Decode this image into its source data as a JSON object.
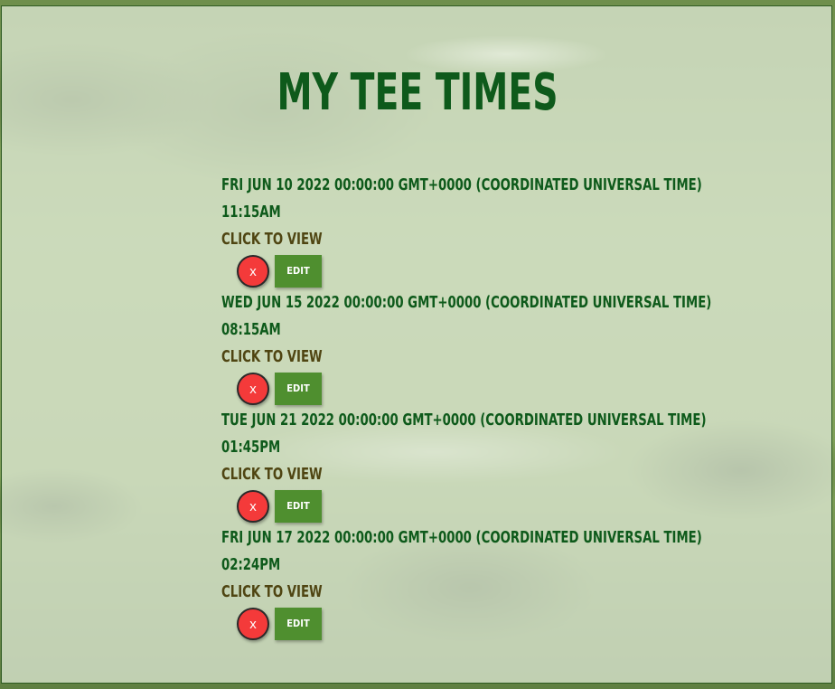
{
  "page": {
    "title": "MY TEE TIMES"
  },
  "tee_times": [
    {
      "date": "Fri Jun 10 2022 00:00:00 GMT+0000 (Coordinated Universal Time)",
      "time": "11:15AM",
      "view_label": "Click to view",
      "delete_label": "x",
      "edit_label": "EDIT"
    },
    {
      "date": "Wed Jun 15 2022 00:00:00 GMT+0000 (Coordinated Universal Time)",
      "time": "08:15AM",
      "view_label": "Click to view",
      "delete_label": "x",
      "edit_label": "EDIT"
    },
    {
      "date": "Tue Jun 21 2022 00:00:00 GMT+0000 (Coordinated Universal Time)",
      "time": "01:45PM",
      "view_label": "Click to view",
      "delete_label": "x",
      "edit_label": "EDIT"
    },
    {
      "date": "Fri Jun 17 2022 00:00:00 GMT+0000 (Coordinated Universal Time)",
      "time": "02:24PM",
      "view_label": "Click to view",
      "delete_label": "x",
      "edit_label": "EDIT"
    }
  ],
  "colors": {
    "title_green": "#0e5a1b",
    "view_brown": "#4f4512",
    "delete_red": "#f43a3a",
    "edit_green": "#4f8f2f"
  }
}
